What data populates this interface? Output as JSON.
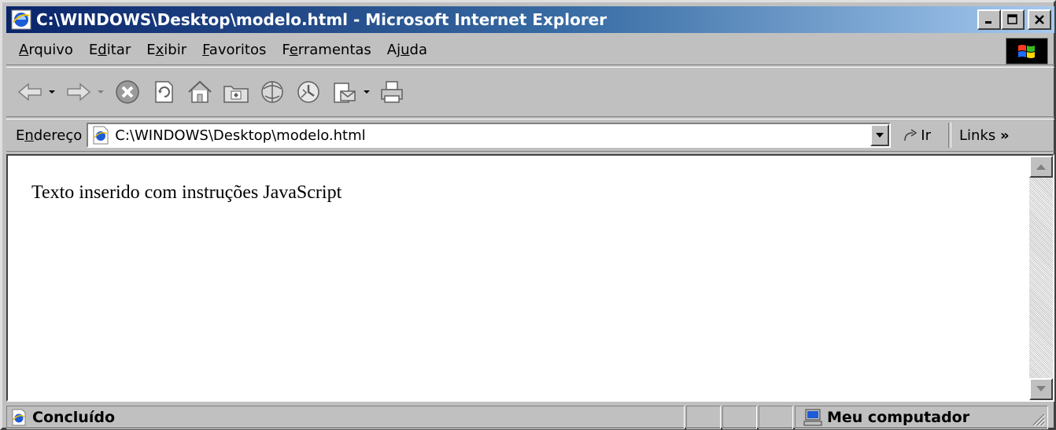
{
  "window": {
    "title": "C:\\WINDOWS\\Desktop\\modelo.html - Microsoft Internet Explorer",
    "app_icon": "ie-icon",
    "controls": [
      "minimize-icon",
      "maximize-icon",
      "close-icon"
    ]
  },
  "menubar": {
    "items": [
      {
        "label_pre": "",
        "label_u": "A",
        "label_post": "rquivo"
      },
      {
        "label_pre": "E",
        "label_u": "d",
        "label_post": "itar"
      },
      {
        "label_pre": "E",
        "label_u": "x",
        "label_post": "ibir"
      },
      {
        "label_pre": "",
        "label_u": "F",
        "label_post": "avoritos"
      },
      {
        "label_pre": "F",
        "label_u": "e",
        "label_post": "rramentas"
      },
      {
        "label_pre": "Aj",
        "label_u": "u",
        "label_post": "da"
      }
    ],
    "throbber_icon": "windows-logo-icon"
  },
  "toolbar": {
    "buttons": [
      "back-icon",
      "forward-icon",
      "stop-icon",
      "refresh-icon",
      "home-icon",
      "search-icon",
      "favorites-icon",
      "history-icon",
      "mail-icon",
      "print-icon"
    ]
  },
  "address": {
    "label_pre": "E",
    "label_u": "n",
    "label_post": "dereço",
    "value": "C:\\WINDOWS\\Desktop\\modelo.html",
    "go_label": "Ir",
    "links_label": "Links",
    "links_chevron": "»"
  },
  "content": {
    "text": "Texto inserido com instruções JavaScript"
  },
  "status": {
    "text": "Concluído",
    "zone": "Meu computador"
  },
  "colors": {
    "title_start": "#0a246a",
    "title_end": "#a6caf0",
    "chrome": "#c0c0c0"
  }
}
